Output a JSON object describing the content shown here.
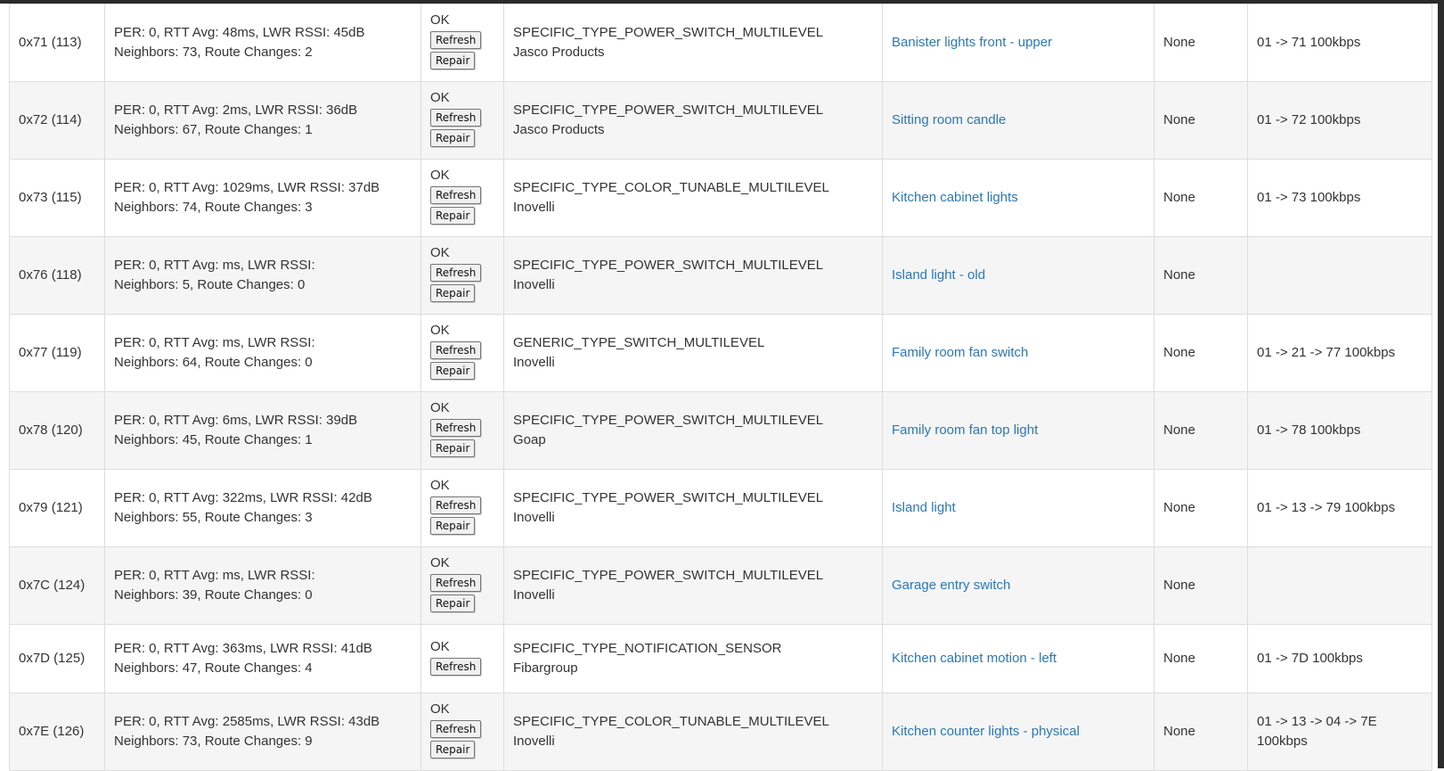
{
  "colors": {
    "link": "#2b78b5",
    "row_alt": "#f5f5f5",
    "border": "#dddddd"
  },
  "rows": [
    {
      "id": "0x71 (113)",
      "stats_line1": "PER: 0, RTT Avg: 48ms, LWR RSSI: 45dB",
      "stats_line2": "Neighbors: 73, Route Changes: 2",
      "status": "OK",
      "refresh": "Refresh",
      "repair": "Repair",
      "type": "SPECIFIC_TYPE_POWER_SWITCH_MULTILEVEL",
      "manufacturer": "Jasco Products",
      "name": "Banister lights front - upper",
      "security": "None",
      "route": "01 -> 71 100kbps"
    },
    {
      "id": "0x72 (114)",
      "stats_line1": "PER: 0, RTT Avg: 2ms, LWR RSSI: 36dB",
      "stats_line2": "Neighbors: 67, Route Changes: 1",
      "status": "OK",
      "refresh": "Refresh",
      "repair": "Repair",
      "type": "SPECIFIC_TYPE_POWER_SWITCH_MULTILEVEL",
      "manufacturer": "Jasco Products",
      "name": "Sitting room candle",
      "security": "None",
      "route": "01 -> 72 100kbps"
    },
    {
      "id": "0x73 (115)",
      "stats_line1": "PER: 0, RTT Avg: 1029ms, LWR RSSI: 37dB",
      "stats_line2": "Neighbors: 74, Route Changes: 3",
      "status": "OK",
      "refresh": "Refresh",
      "repair": "Repair",
      "type": "SPECIFIC_TYPE_COLOR_TUNABLE_MULTILEVEL",
      "manufacturer": "Inovelli",
      "name": "Kitchen cabinet lights",
      "security": "None",
      "route": "01 -> 73 100kbps"
    },
    {
      "id": "0x76 (118)",
      "stats_line1": "PER: 0, RTT Avg: ms, LWR RSSI:",
      "stats_line2": "Neighbors: 5, Route Changes: 0",
      "status": "OK",
      "refresh": "Refresh",
      "repair": "Repair",
      "type": "SPECIFIC_TYPE_POWER_SWITCH_MULTILEVEL",
      "manufacturer": "Inovelli",
      "name": "Island light - old",
      "security": "None",
      "route": ""
    },
    {
      "id": "0x77 (119)",
      "stats_line1": "PER: 0, RTT Avg: ms, LWR RSSI:",
      "stats_line2": "Neighbors: 64, Route Changes: 0",
      "status": "OK",
      "refresh": "Refresh",
      "repair": "Repair",
      "type": "GENERIC_TYPE_SWITCH_MULTILEVEL",
      "manufacturer": "Inovelli",
      "name": "Family room fan switch",
      "security": "None",
      "route": "01 -> 21 -> 77 100kbps"
    },
    {
      "id": "0x78 (120)",
      "stats_line1": "PER: 0, RTT Avg: 6ms, LWR RSSI: 39dB",
      "stats_line2": "Neighbors: 45, Route Changes: 1",
      "status": "OK",
      "refresh": "Refresh",
      "repair": "Repair",
      "type": "SPECIFIC_TYPE_POWER_SWITCH_MULTILEVEL",
      "manufacturer": "Goap",
      "name": "Family room fan top light",
      "security": "None",
      "route": "01 -> 78 100kbps"
    },
    {
      "id": "0x79 (121)",
      "stats_line1": "PER: 0, RTT Avg: 322ms, LWR RSSI: 42dB",
      "stats_line2": "Neighbors: 55, Route Changes: 3",
      "status": "OK",
      "refresh": "Refresh",
      "repair": "Repair",
      "type": "SPECIFIC_TYPE_POWER_SWITCH_MULTILEVEL",
      "manufacturer": "Inovelli",
      "name": "Island light",
      "security": "None",
      "route": "01 -> 13 -> 79 100kbps"
    },
    {
      "id": "0x7C (124)",
      "stats_line1": "PER: 0, RTT Avg: ms, LWR RSSI:",
      "stats_line2": "Neighbors: 39, Route Changes: 0",
      "status": "OK",
      "refresh": "Refresh",
      "repair": "Repair",
      "type": "SPECIFIC_TYPE_POWER_SWITCH_MULTILEVEL",
      "manufacturer": "Inovelli",
      "name": "Garage entry switch",
      "security": "None",
      "route": ""
    },
    {
      "id": "0x7D (125)",
      "stats_line1": "PER: 0, RTT Avg: 363ms, LWR RSSI: 41dB",
      "stats_line2": "Neighbors: 47, Route Changes: 4",
      "status": "OK",
      "refresh": "Refresh",
      "type": "SPECIFIC_TYPE_NOTIFICATION_SENSOR",
      "manufacturer": "Fibargroup",
      "name": "Kitchen cabinet motion - left",
      "security": "None",
      "route": "01 -> 7D 100kbps"
    },
    {
      "id": "0x7E (126)",
      "stats_line1": "PER: 0, RTT Avg: 2585ms, LWR RSSI: 43dB",
      "stats_line2": "Neighbors: 73, Route Changes: 9",
      "status": "OK",
      "refresh": "Refresh",
      "repair": "Repair",
      "type": "SPECIFIC_TYPE_COLOR_TUNABLE_MULTILEVEL",
      "manufacturer": "Inovelli",
      "name": "Kitchen counter lights - physical",
      "security": "None",
      "route": "01 -> 13 -> 04 -> 7E 100kbps"
    }
  ]
}
